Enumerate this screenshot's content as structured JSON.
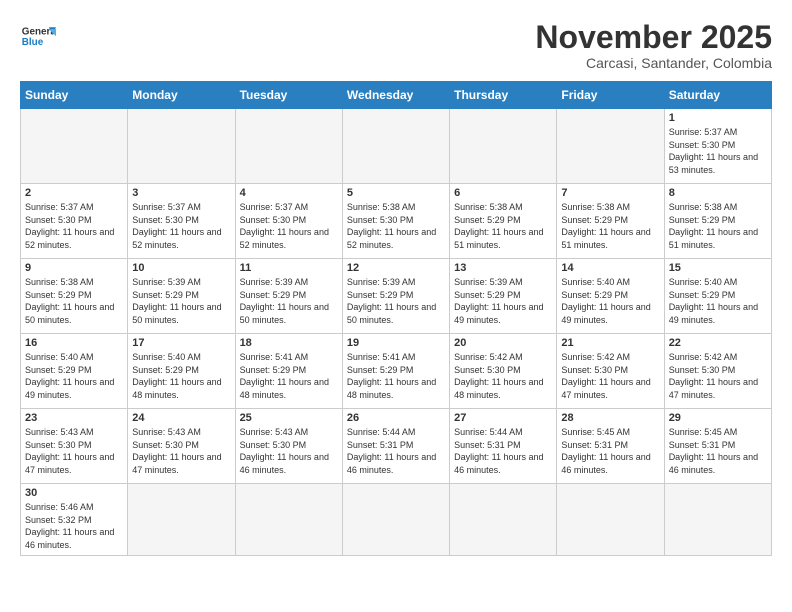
{
  "header": {
    "logo_line1": "General",
    "logo_line2": "Blue",
    "month_title": "November 2025",
    "subtitle": "Carcasi, Santander, Colombia"
  },
  "days_of_week": [
    "Sunday",
    "Monday",
    "Tuesday",
    "Wednesday",
    "Thursday",
    "Friday",
    "Saturday"
  ],
  "weeks": [
    [
      {
        "day": "",
        "info": ""
      },
      {
        "day": "",
        "info": ""
      },
      {
        "day": "",
        "info": ""
      },
      {
        "day": "",
        "info": ""
      },
      {
        "day": "",
        "info": ""
      },
      {
        "day": "",
        "info": ""
      },
      {
        "day": "1",
        "info": "Sunrise: 5:37 AM\nSunset: 5:30 PM\nDaylight: 11 hours and 53 minutes."
      }
    ],
    [
      {
        "day": "2",
        "info": "Sunrise: 5:37 AM\nSunset: 5:30 PM\nDaylight: 11 hours and 52 minutes."
      },
      {
        "day": "3",
        "info": "Sunrise: 5:37 AM\nSunset: 5:30 PM\nDaylight: 11 hours and 52 minutes."
      },
      {
        "day": "4",
        "info": "Sunrise: 5:37 AM\nSunset: 5:30 PM\nDaylight: 11 hours and 52 minutes."
      },
      {
        "day": "5",
        "info": "Sunrise: 5:38 AM\nSunset: 5:30 PM\nDaylight: 11 hours and 52 minutes."
      },
      {
        "day": "6",
        "info": "Sunrise: 5:38 AM\nSunset: 5:29 PM\nDaylight: 11 hours and 51 minutes."
      },
      {
        "day": "7",
        "info": "Sunrise: 5:38 AM\nSunset: 5:29 PM\nDaylight: 11 hours and 51 minutes."
      },
      {
        "day": "8",
        "info": "Sunrise: 5:38 AM\nSunset: 5:29 PM\nDaylight: 11 hours and 51 minutes."
      }
    ],
    [
      {
        "day": "9",
        "info": "Sunrise: 5:38 AM\nSunset: 5:29 PM\nDaylight: 11 hours and 50 minutes."
      },
      {
        "day": "10",
        "info": "Sunrise: 5:39 AM\nSunset: 5:29 PM\nDaylight: 11 hours and 50 minutes."
      },
      {
        "day": "11",
        "info": "Sunrise: 5:39 AM\nSunset: 5:29 PM\nDaylight: 11 hours and 50 minutes."
      },
      {
        "day": "12",
        "info": "Sunrise: 5:39 AM\nSunset: 5:29 PM\nDaylight: 11 hours and 50 minutes."
      },
      {
        "day": "13",
        "info": "Sunrise: 5:39 AM\nSunset: 5:29 PM\nDaylight: 11 hours and 49 minutes."
      },
      {
        "day": "14",
        "info": "Sunrise: 5:40 AM\nSunset: 5:29 PM\nDaylight: 11 hours and 49 minutes."
      },
      {
        "day": "15",
        "info": "Sunrise: 5:40 AM\nSunset: 5:29 PM\nDaylight: 11 hours and 49 minutes."
      }
    ],
    [
      {
        "day": "16",
        "info": "Sunrise: 5:40 AM\nSunset: 5:29 PM\nDaylight: 11 hours and 49 minutes."
      },
      {
        "day": "17",
        "info": "Sunrise: 5:40 AM\nSunset: 5:29 PM\nDaylight: 11 hours and 48 minutes."
      },
      {
        "day": "18",
        "info": "Sunrise: 5:41 AM\nSunset: 5:29 PM\nDaylight: 11 hours and 48 minutes."
      },
      {
        "day": "19",
        "info": "Sunrise: 5:41 AM\nSunset: 5:29 PM\nDaylight: 11 hours and 48 minutes."
      },
      {
        "day": "20",
        "info": "Sunrise: 5:42 AM\nSunset: 5:30 PM\nDaylight: 11 hours and 48 minutes."
      },
      {
        "day": "21",
        "info": "Sunrise: 5:42 AM\nSunset: 5:30 PM\nDaylight: 11 hours and 47 minutes."
      },
      {
        "day": "22",
        "info": "Sunrise: 5:42 AM\nSunset: 5:30 PM\nDaylight: 11 hours and 47 minutes."
      }
    ],
    [
      {
        "day": "23",
        "info": "Sunrise: 5:43 AM\nSunset: 5:30 PM\nDaylight: 11 hours and 47 minutes."
      },
      {
        "day": "24",
        "info": "Sunrise: 5:43 AM\nSunset: 5:30 PM\nDaylight: 11 hours and 47 minutes."
      },
      {
        "day": "25",
        "info": "Sunrise: 5:43 AM\nSunset: 5:30 PM\nDaylight: 11 hours and 46 minutes."
      },
      {
        "day": "26",
        "info": "Sunrise: 5:44 AM\nSunset: 5:31 PM\nDaylight: 11 hours and 46 minutes."
      },
      {
        "day": "27",
        "info": "Sunrise: 5:44 AM\nSunset: 5:31 PM\nDaylight: 11 hours and 46 minutes."
      },
      {
        "day": "28",
        "info": "Sunrise: 5:45 AM\nSunset: 5:31 PM\nDaylight: 11 hours and 46 minutes."
      },
      {
        "day": "29",
        "info": "Sunrise: 5:45 AM\nSunset: 5:31 PM\nDaylight: 11 hours and 46 minutes."
      }
    ],
    [
      {
        "day": "30",
        "info": "Sunrise: 5:46 AM\nSunset: 5:32 PM\nDaylight: 11 hours and 46 minutes."
      },
      {
        "day": "",
        "info": ""
      },
      {
        "day": "",
        "info": ""
      },
      {
        "day": "",
        "info": ""
      },
      {
        "day": "",
        "info": ""
      },
      {
        "day": "",
        "info": ""
      },
      {
        "day": "",
        "info": ""
      }
    ]
  ],
  "colors": {
    "header_bg": "#2a7fc1",
    "logo_blue": "#1a7dc4"
  }
}
